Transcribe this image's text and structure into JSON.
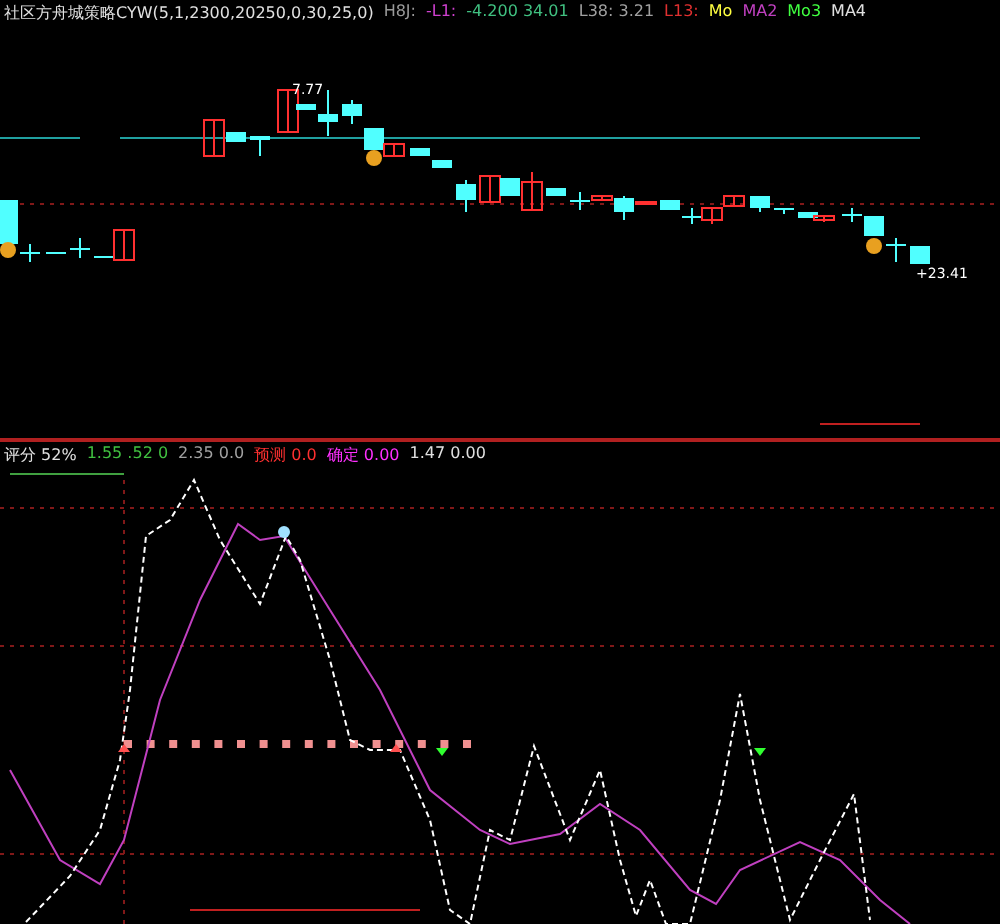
{
  "main_panel": {
    "legend": [
      {
        "text": "社区方舟城策略CYW(5,1,2300,20250,0,30,25,0)",
        "color": "#e0e0e0"
      },
      {
        "text": "H8J:",
        "color": "#9a9a9a"
      },
      {
        "text": "-L1:",
        "color": "#d040d0"
      },
      {
        "text": "-4.200 34.01",
        "color": "#40c080"
      },
      {
        "text": "L38: 3.21",
        "color": "#a0a0a0"
      },
      {
        "text": "L13:",
        "color": "#e03030"
      },
      {
        "text": "Mo",
        "color": "#ffff40"
      },
      {
        "text": "MA2",
        "color": "#c040c0"
      },
      {
        "text": "Mo3",
        "color": "#40ff40"
      },
      {
        "text": "MA4",
        "color": "#e0e0e0"
      }
    ],
    "high_label": "7.77",
    "low_label": "+23.41"
  },
  "sub_panel": {
    "legend": [
      {
        "text": "评分 52%",
        "color": "#e0e0e0"
      },
      {
        "text": "1.55 .52 0",
        "color": "#40c040"
      },
      {
        "text": "2.35 0.0",
        "color": "#a0a0a0"
      },
      {
        "text": "预测 0.0",
        "color": "#ff3030"
      },
      {
        "text": "确定 0.00",
        "color": "#ff30ff"
      },
      {
        "text": "1.47 0.00",
        "color": "#e0e0e0"
      }
    ]
  }
}
